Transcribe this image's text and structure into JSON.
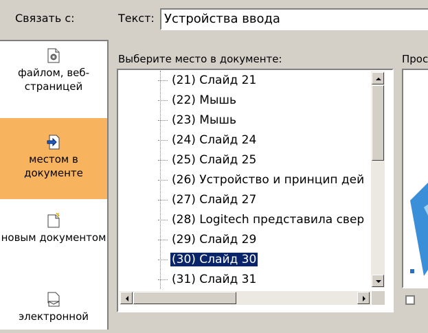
{
  "link_with": {
    "label": "Связать с:"
  },
  "text_field": {
    "label": "Текст:",
    "value": "Устройства ввода"
  },
  "sidebar": {
    "items": [
      {
        "label": "файлом, веб-страницей",
        "icon": "file-web-icon",
        "active": false
      },
      {
        "label": "местом в документе",
        "icon": "place-in-document-icon",
        "active": true
      },
      {
        "label": "новым документом",
        "icon": "new-document-icon",
        "active": false
      },
      {
        "label": "электронной",
        "icon": "email-icon",
        "active": false
      }
    ]
  },
  "place_list": {
    "label": "Выберите место в документе:",
    "items": [
      "(21) Слайд 21",
      "(22) Мышь",
      "(23) Мышь",
      "(24) Слайд 24",
      "(25) Слайд 25",
      "(26) Устройство и принцип дей",
      "(27) Слайд 27",
      "(28) Logitech представила свер",
      "(29) Слайд 29",
      "(30) Слайд 30",
      "(31) Слайд 31"
    ],
    "selected_index": 9
  },
  "preview": {
    "label": "Прос"
  },
  "colors": {
    "active_item": "#f7b35e",
    "selection": "#0a246a",
    "dialog_bg": "#d4d0c8"
  }
}
